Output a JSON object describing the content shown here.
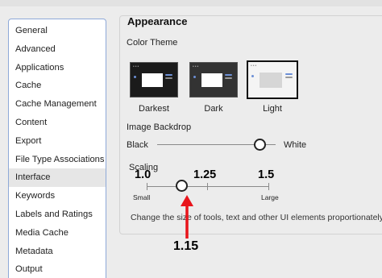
{
  "sidebar": {
    "items": [
      {
        "label": "General",
        "selected": false
      },
      {
        "label": "Advanced",
        "selected": false
      },
      {
        "label": "Applications",
        "selected": false
      },
      {
        "label": "Cache",
        "selected": false
      },
      {
        "label": "Cache Management",
        "selected": false
      },
      {
        "label": "Content",
        "selected": false
      },
      {
        "label": "Export",
        "selected": false
      },
      {
        "label": "File Type Associations",
        "selected": false
      },
      {
        "label": "Interface",
        "selected": true
      },
      {
        "label": "Keywords",
        "selected": false
      },
      {
        "label": "Labels and Ratings",
        "selected": false
      },
      {
        "label": "Media Cache",
        "selected": false
      },
      {
        "label": "Metadata",
        "selected": false
      },
      {
        "label": "Output",
        "selected": false
      }
    ]
  },
  "appearance": {
    "title": "Appearance",
    "color_theme_label": "Color Theme",
    "themes": [
      {
        "label": "Darkest",
        "selected": false
      },
      {
        "label": "Dark",
        "selected": false
      },
      {
        "label": "Light",
        "selected": true
      }
    ],
    "image_backdrop": {
      "label": "Image Backdrop",
      "min_label": "Black",
      "max_label": "White",
      "value_fraction": 0.87
    },
    "scaling": {
      "label": "Scaling",
      "small_label": "Small",
      "large_label": "Large",
      "description": "Change the size of tools, text and other UI elements proportionately.",
      "value": 1.15
    }
  },
  "annotations": {
    "tick_min": "1.0",
    "tick_mid": "1.25",
    "tick_max": "1.5",
    "pointer_value": "1.15",
    "arrow_color": "#e8141b"
  },
  "colors": {
    "accent": "#e8141b",
    "sidebar_border": "#8ea9d8",
    "selected_bg": "#e6e6e6"
  }
}
